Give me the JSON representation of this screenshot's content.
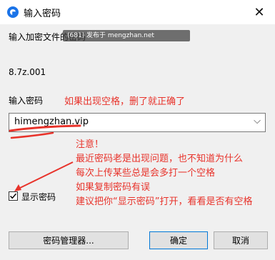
{
  "window": {
    "title": "输入密码",
    "close_glyph": "✕"
  },
  "dialog": {
    "label": "输入加密文件的密码",
    "watermark": "(681) 发布于 mengzhan.net",
    "archive_name": "8.7z.001",
    "password_label": "输入密码",
    "password_value": "himengzhan.vip",
    "show_password_label": "显示密码",
    "show_password_checked": true
  },
  "annotations": {
    "top_note": "如果出现空格，删了就正确了",
    "notes": [
      "注意！",
      "最近密码老是出现问题，也不知道为什么",
      "每次上传某些总是会多打一个空格",
      "如果复制密码有误",
      "建议把你“显示密码”打开，看看是否有空格"
    ],
    "color": "#e8332b"
  },
  "buttons": {
    "manage": "密码管理器...",
    "ok": "确定",
    "cancel": "取消"
  },
  "icons": {
    "app": "app-icon",
    "close": "close-icon",
    "dropdown": "chevron-down-icon",
    "check": "check-icon"
  }
}
